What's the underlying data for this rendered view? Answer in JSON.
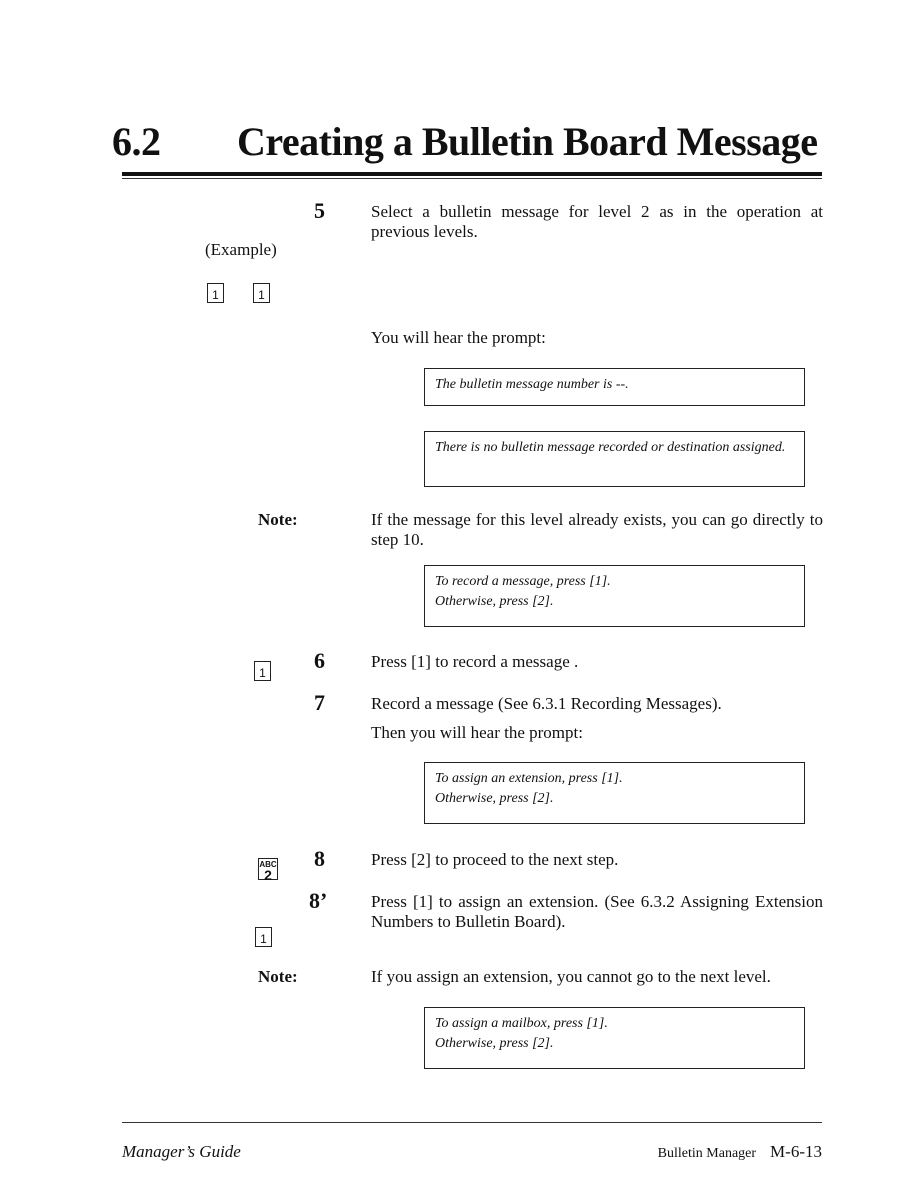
{
  "header": {
    "section_number": "6.2",
    "section_title": "Creating a Bulletin Board Message"
  },
  "steps": {
    "step5": {
      "number": "5",
      "text": "Select a bulletin message for level 2 as in the operation at previous levels.",
      "side_label": "(Example)",
      "keys": [
        "1",
        "1"
      ]
    },
    "prompt_intro": "You will hear the prompt:",
    "prompt1": "The bulletin message number is --.",
    "prompt2": "There is no bulletin message recorded or destination assigned.",
    "note1": {
      "label": "Note:",
      "text": "If the message for this level already exists, you can go directly to step 10."
    },
    "prompt3": {
      "line1": "To record a message, press [1].",
      "line2": "Otherwise, press [2]."
    },
    "step6": {
      "number": "6",
      "text": "Press [1] to record a message .",
      "key": "1"
    },
    "step7": {
      "number": "7",
      "text": "Record a message (See 6.3.1 Recording Messages).",
      "followup": "Then you will hear the prompt:"
    },
    "prompt4": {
      "line1": "To assign an extension, press [1].",
      "line2": "Otherwise, press [2]."
    },
    "step8": {
      "number": "8",
      "text": "Press [2] to proceed to the next step.",
      "key_letters": "ABC",
      "key_digit": "2"
    },
    "step8alt": {
      "number": "8’",
      "text": "Press [1] to assign an extension. (See 6.3.2 Assigning Extension Numbers to Bulletin Board).",
      "key": "1"
    },
    "note2": {
      "label": "Note:",
      "text": "If you assign an extension, you cannot go to the next level."
    },
    "prompt5": {
      "line1": "To assign a mailbox, press [1].",
      "line2": "Otherwise, press [2]."
    }
  },
  "footer": {
    "left": "Manager’s Guide",
    "section": "Bulletin Manager",
    "page": "M-6-13"
  }
}
